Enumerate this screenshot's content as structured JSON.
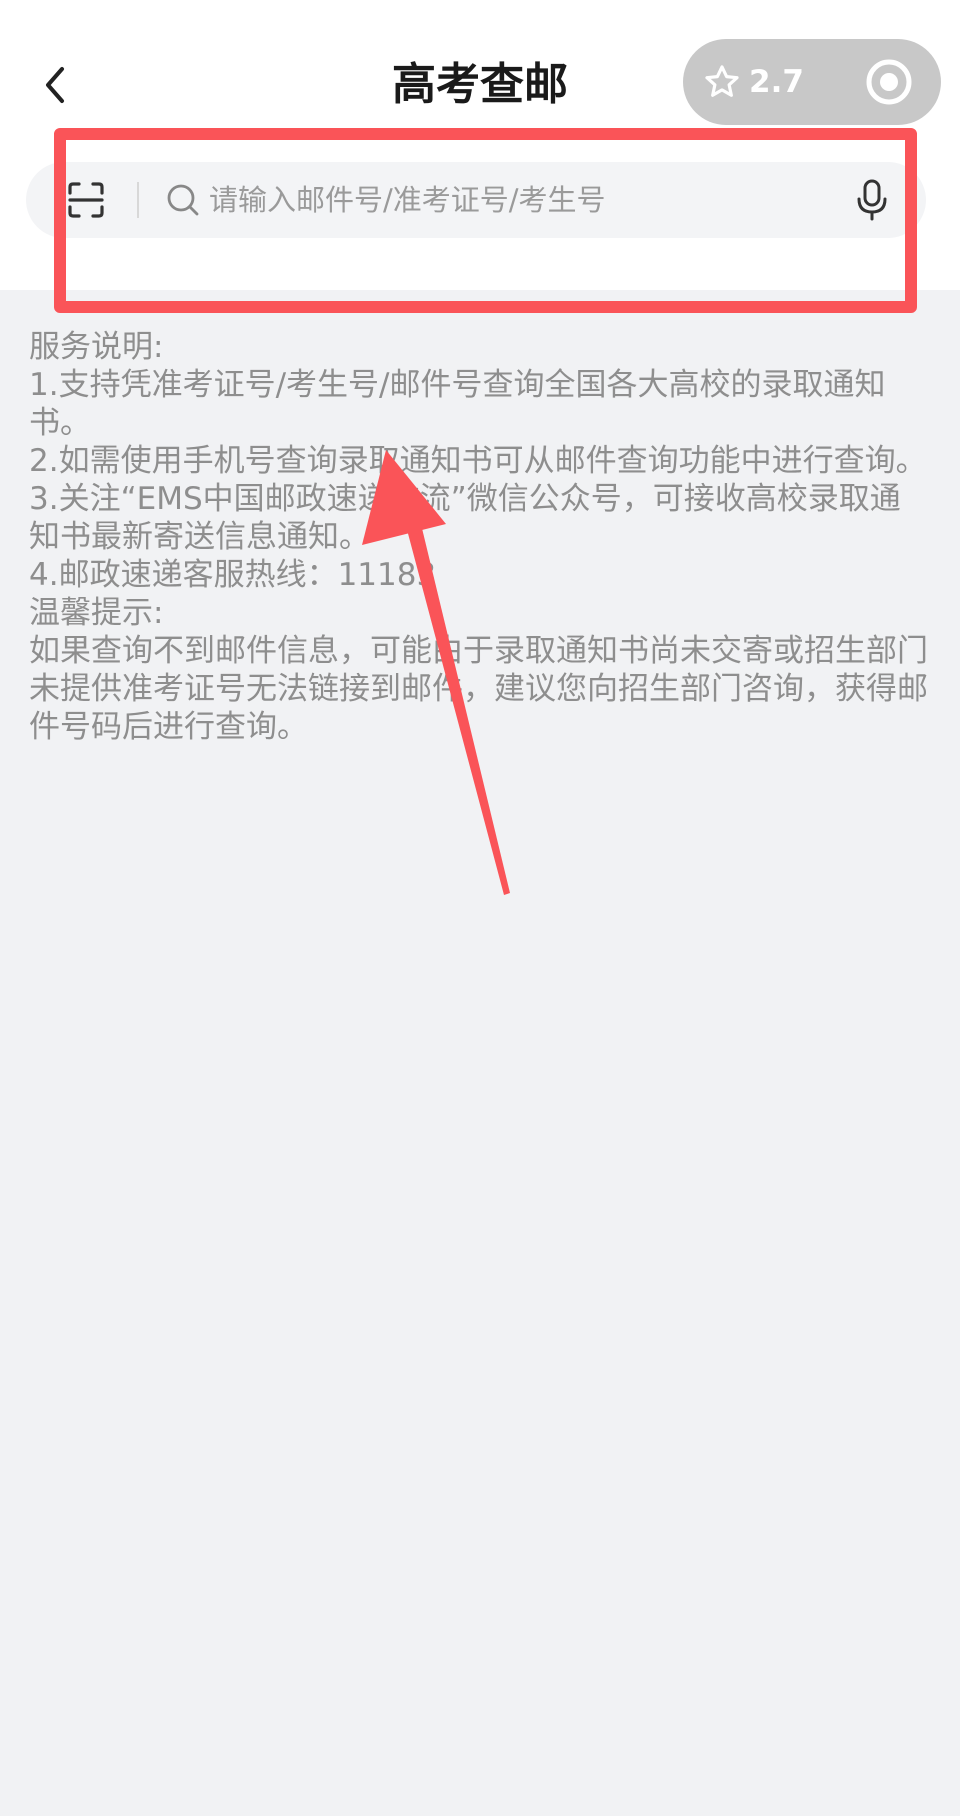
{
  "header": {
    "title": "高考查邮",
    "back_icon": "chevron-left-icon",
    "capsule": {
      "rating": "2.7",
      "star_icon": "star-outline-icon",
      "close_icon": "target-circle-icon"
    }
  },
  "search": {
    "placeholder": "请输入邮件号/准考证号/考生号",
    "value": "",
    "scan_icon": "scan-icon",
    "search_icon": "search-icon",
    "voice_icon": "microphone-icon"
  },
  "notes": {
    "service_heading": "服务说明:",
    "item1": "1.支持凭准考证号/考生号/邮件号查询全国各大高校的录取通知书。",
    "item2": "2.如需使用手机号查询录取通知书可从邮件查询功能中进行查询。",
    "item3": "3.关注“EMS中国邮政速递物流”微信公众号，可接收高校录取通知书最新寄送信息通知。",
    "item4": "4.邮政速递客服热线：11183",
    "tips_heading": "温馨提示:",
    "tips_body": "如果查询不到邮件信息，可能由于录取通知书尚未交寄或招生部门未提供准考证号无法链接到邮件，建议您向招生部门咨询，获得邮件号码后进行查询。"
  },
  "annotation": {
    "color": "#fa5458"
  },
  "colors": {
    "background": "#f1f2f4",
    "header": "#ffffff",
    "capsule": "#c8c8c8",
    "note_text": "#8e8e8e"
  }
}
